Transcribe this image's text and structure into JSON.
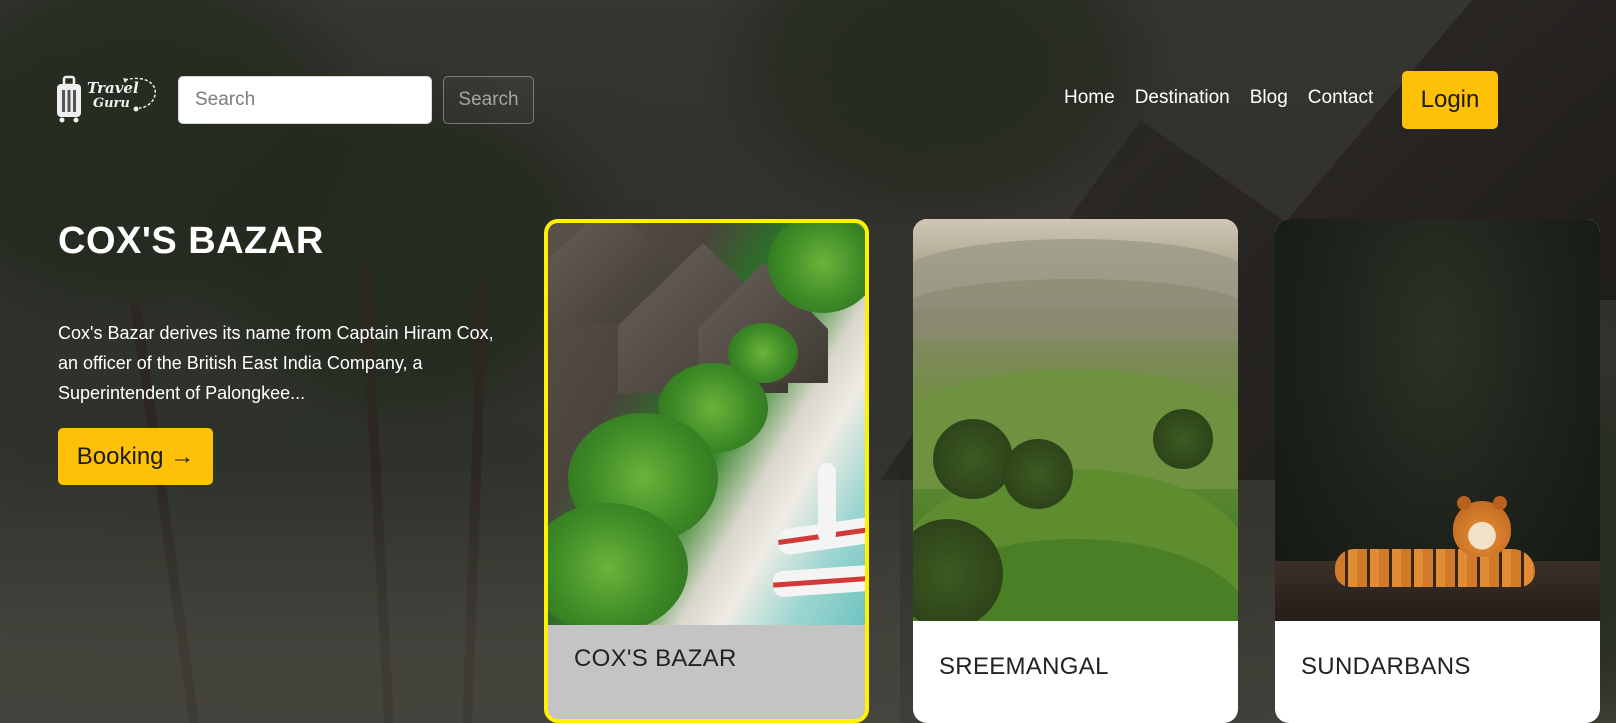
{
  "brand": {
    "logo_line1": "Travel",
    "logo_line2": "Guru"
  },
  "search": {
    "placeholder": "Search",
    "button_label": "Search"
  },
  "nav": {
    "links": [
      "Home",
      "Destination",
      "Blog",
      "Contact"
    ],
    "login_label": "Login"
  },
  "hero": {
    "title": "COX'S BAZAR",
    "description": "Cox's Bazar derives its name from Captain Hiram Cox, an officer of the British East India Company, a Superintendent of Palongkee...",
    "booking_label": "Booking →"
  },
  "cards": [
    {
      "title": "COX'S BAZAR",
      "image_icon": "beach-aerial-photo",
      "selected": true
    },
    {
      "title": "SREEMANGAL",
      "image_icon": "tea-hills-photo",
      "selected": false
    },
    {
      "title": "SUNDARBANS",
      "image_icon": "tiger-jungle-photo",
      "selected": false
    }
  ],
  "colors": {
    "accent": "#ffc107",
    "selected_border": "#fff200",
    "selected_card_bg": "#c4c4c4",
    "card_bg": "#ffffff"
  }
}
